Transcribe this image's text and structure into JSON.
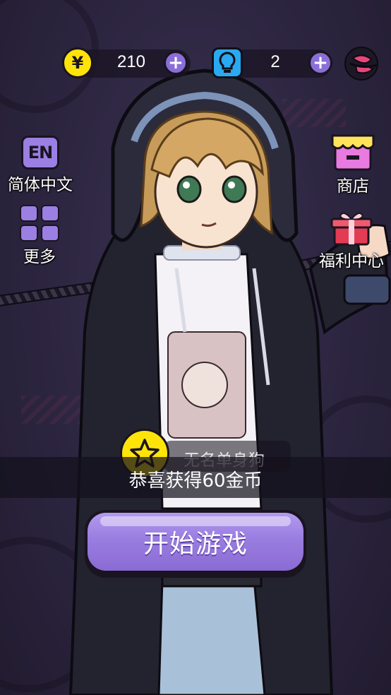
{
  "resources": {
    "coin_symbol": "¥",
    "coins": "210",
    "hints": "2"
  },
  "menu": {
    "language_label": "简体中文",
    "language_icon_text": "EN",
    "more_label": "更多",
    "shop_label": "商店",
    "welfare_label": "福利中心"
  },
  "notification": {
    "player_name": "无名单身狗",
    "message": "恭喜获得60金币"
  },
  "start_button": {
    "label": "开始游戏"
  },
  "colors": {
    "accent_purple": "#9a7de0",
    "coin_yellow": "#ffe40a",
    "hint_blue": "#2aa9f0",
    "shop_pink": "#e87ae0",
    "gift_red": "#e23c55"
  },
  "icons": {
    "coin": "coin-icon",
    "hint": "lightbulb-icon",
    "plus": "plus-icon",
    "avatar": "avatar-icon",
    "language": "language-icon",
    "more": "grid-icon",
    "shop": "shop-icon",
    "gift": "gift-icon",
    "star": "star-icon"
  }
}
